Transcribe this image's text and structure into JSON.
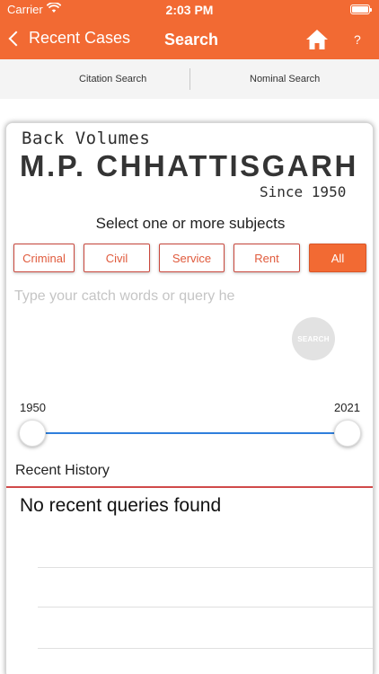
{
  "status": {
    "carrier": "Carrier",
    "time": "2:03 PM"
  },
  "nav": {
    "back_label": "Recent Cases",
    "title": "Search",
    "help": "?"
  },
  "tabs": {
    "citation": "Citation Search",
    "nominal": "Nominal Search"
  },
  "logo": {
    "line1": "Back Volumes",
    "line2": "M.P. CHHATTISGARH",
    "line3": "Since 1950"
  },
  "subjects": {
    "prompt": "Select one or more subjects",
    "items": [
      "Criminal",
      "Civil",
      "Service",
      "Rent",
      "All"
    ],
    "selected": "All"
  },
  "query": {
    "placeholder": "Type your catch words or query he"
  },
  "search_button": "SEARCH",
  "year_range": {
    "min": "1950",
    "max": "2021"
  },
  "history": {
    "title": "Recent History",
    "empty": "No recent queries found"
  },
  "colors": {
    "accent": "#f26a33",
    "slider": "#2f7fdc",
    "separator": "#d04a4a"
  }
}
